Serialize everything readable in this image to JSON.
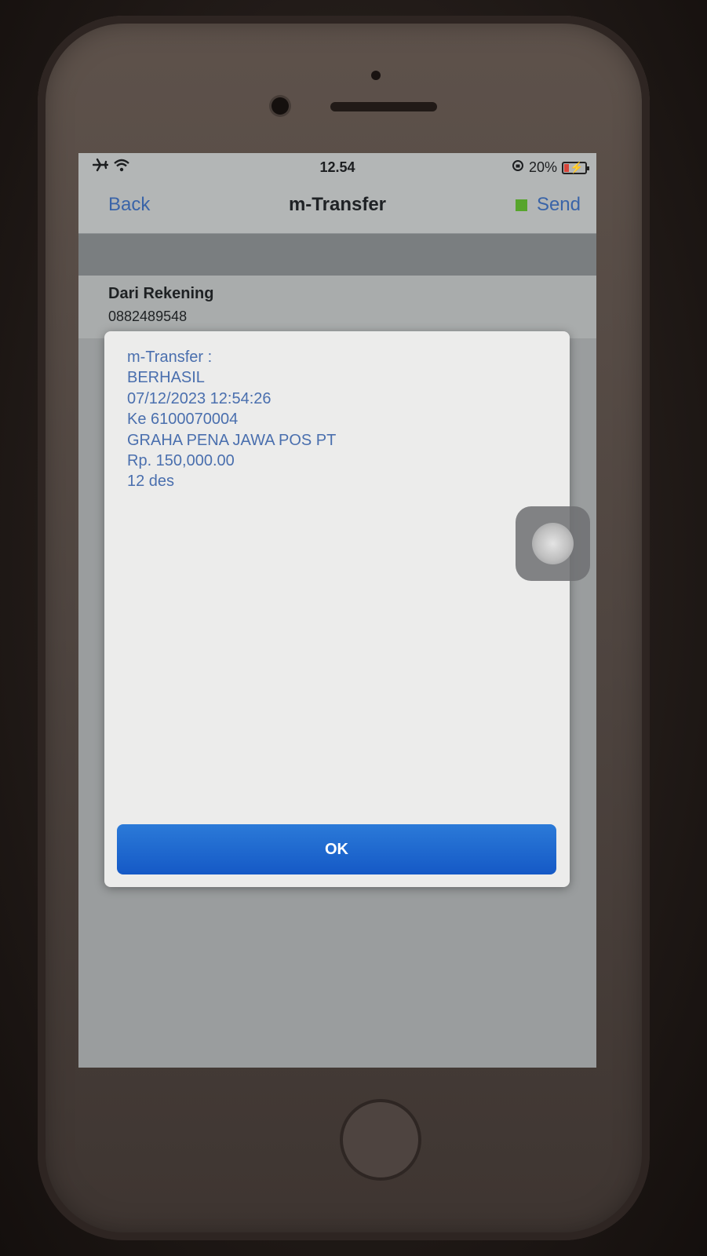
{
  "status_bar": {
    "time": "12.54",
    "battery_percent": "20%",
    "battery_level": 0.2,
    "icons": [
      "airplane-icon",
      "wifi-icon",
      "orientation-lock-icon",
      "battery-charging-icon"
    ]
  },
  "nav": {
    "back_label": "Back",
    "title": "m-Transfer",
    "send_label": "Send",
    "send_indicator_color": "#57a52c"
  },
  "account": {
    "label": "Dari Rekening",
    "number": "0882489548"
  },
  "dialog": {
    "lines": [
      "m-Transfer :",
      "BERHASIL",
      "07/12/2023 12:54:26",
      "Ke 6100070004",
      "GRAHA PENA JAWA POS PT",
      "Rp. 150,000.00",
      "12 des"
    ],
    "ok_label": "OK"
  },
  "colors": {
    "link_blue": "#3a64a8",
    "message_text": "#4a6fae",
    "ok_button": "#1f66cf"
  }
}
